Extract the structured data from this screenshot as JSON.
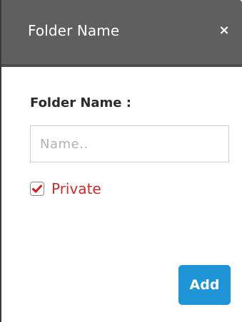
{
  "dialog": {
    "title": "Folder Name",
    "close_glyph": "×",
    "close_icon": "close-icon"
  },
  "form": {
    "field_label": "Folder Name :",
    "name_placeholder": "Name..",
    "name_value": "",
    "private_label": "Private",
    "private_checked": true,
    "add_label": "Add"
  },
  "colors": {
    "title_bar": "#5f5f5f",
    "accent_button": "#1f95d8",
    "private_text": "#cc2b2b",
    "checkmark": "#cc1f1f"
  }
}
